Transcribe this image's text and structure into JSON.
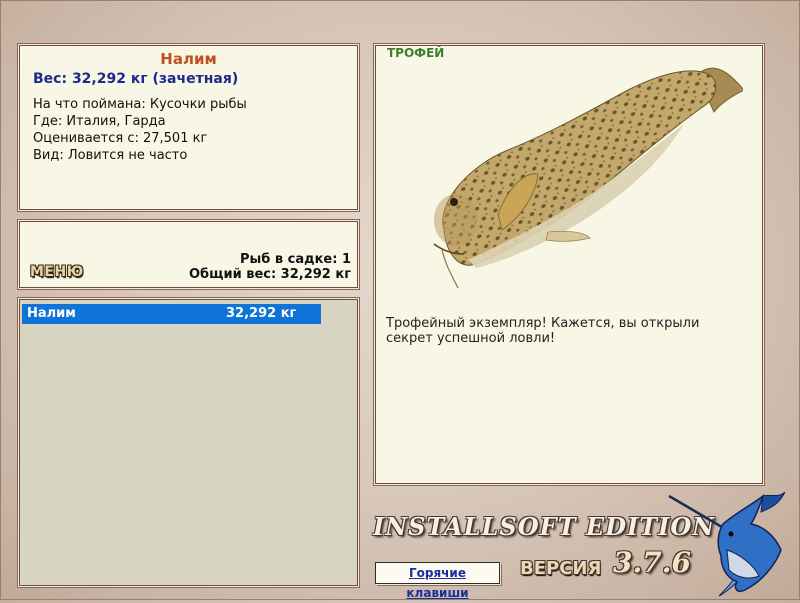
{
  "fish_info": {
    "name": "Налим",
    "weight_line": "Вес: 32,292 кг (зачетная)",
    "bait_line": "На что поймана: Кусочки рыбы",
    "location_line": "Где: Италия, Гарда",
    "estimate_line": "Оценивается с: 27,501 кг",
    "rarity_line": "Вид: Ловится не часто"
  },
  "status": {
    "menu_label": "МЕНЮ",
    "fish_count_line": "Рыб в садке: 1",
    "total_weight_line": "Общий вес: 32,292 кг"
  },
  "catch_list": [
    {
      "name": "Налим",
      "weight": "32,292 кг",
      "selected": true
    }
  ],
  "trophy": {
    "badge": "ТРОФЕЙ",
    "description": "Трофейный экземпляр! Кажется, вы открыли секрет успешной ловли!",
    "fish_image_icon": "burbot-fish-image"
  },
  "footer": {
    "brand": "INSTALLSOFT EDITION",
    "hotkeys_label": "Горячие клавиши",
    "version_label": "ВЕРСИЯ",
    "version_number": "3.7.6",
    "logo_icon": "marlin-logo-icon"
  },
  "colors": {
    "selection": "#0f73d7",
    "title": "#c0501f",
    "weight": "#1c2a8a",
    "badge": "#3f7d2c",
    "panel_bg": "#f8f6e4"
  }
}
